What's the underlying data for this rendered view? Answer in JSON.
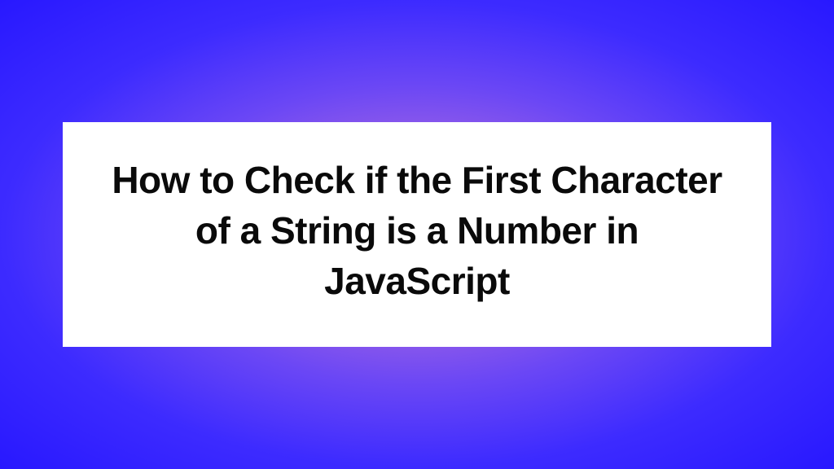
{
  "card": {
    "title": "How to Check if the First Character of a String is a Number in JavaScript"
  }
}
